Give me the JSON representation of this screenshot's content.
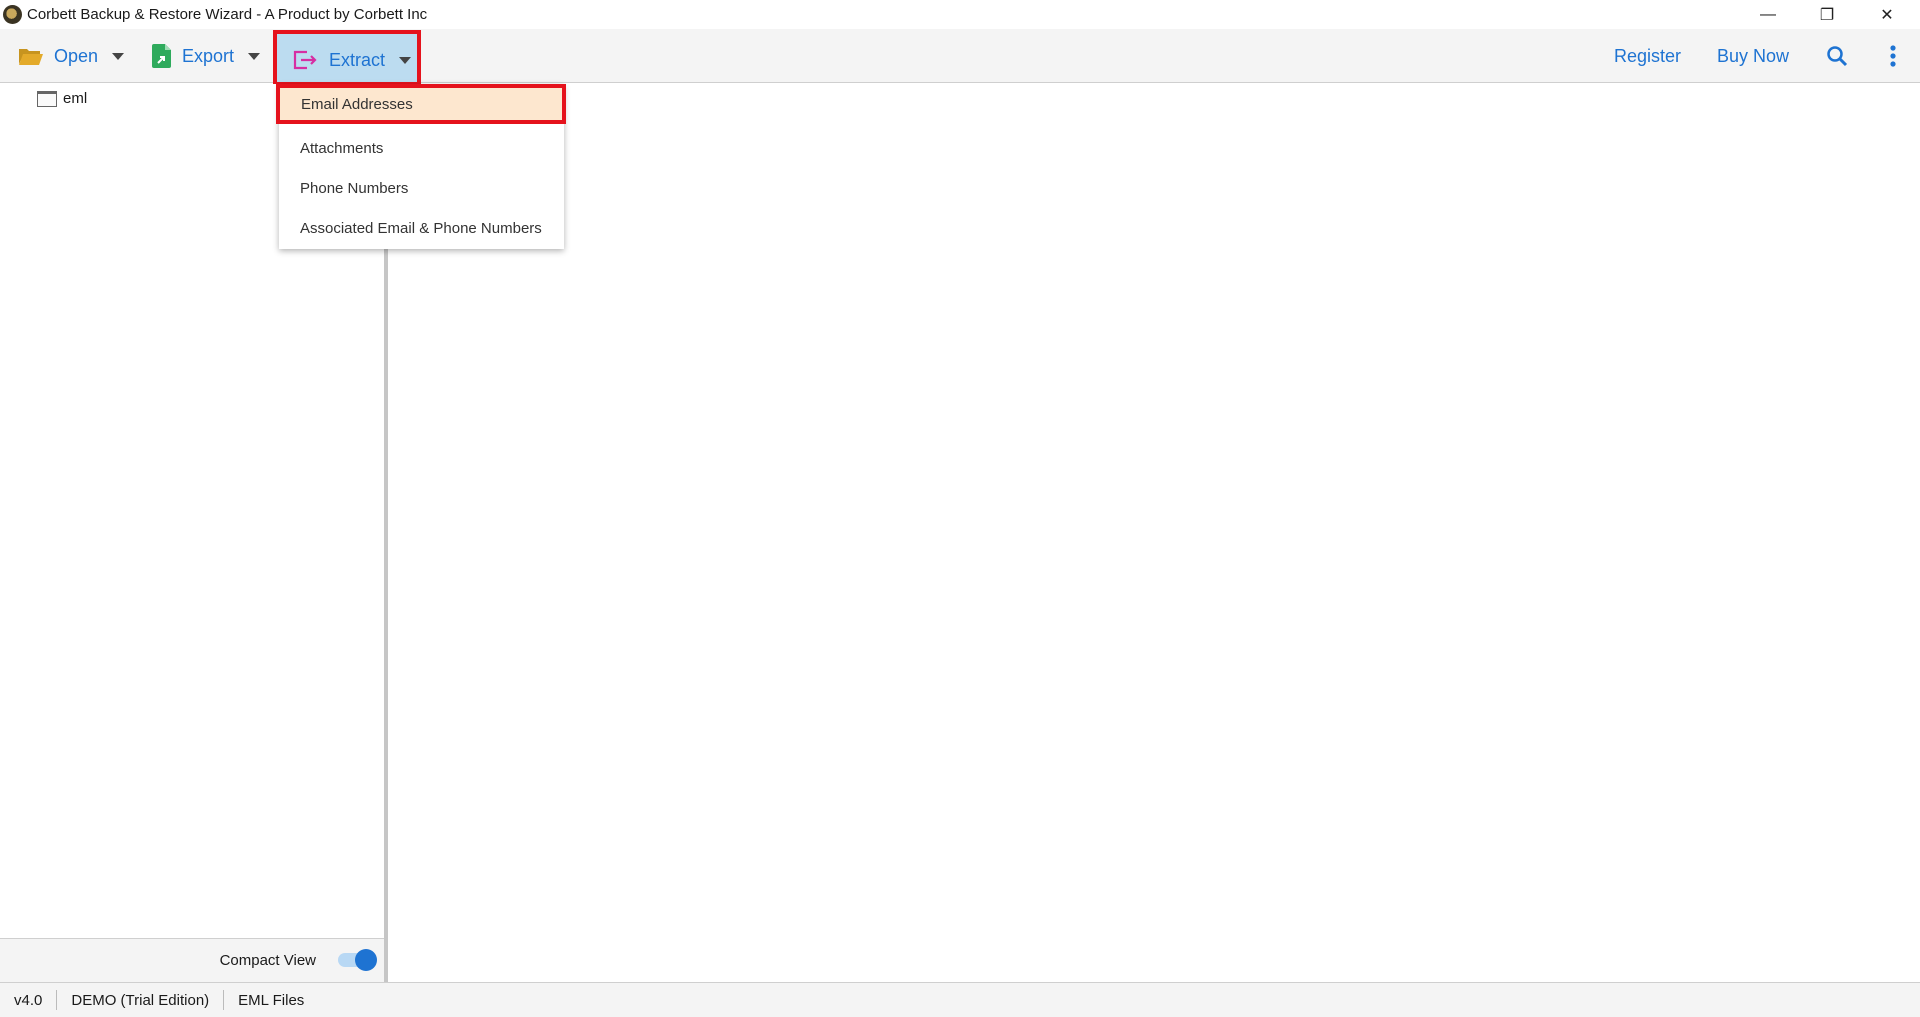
{
  "window": {
    "title": "Corbett Backup & Restore Wizard - A Product by Corbett Inc",
    "controls": {
      "minimize": "—",
      "restore": "❐",
      "close": "✕"
    }
  },
  "toolbar": {
    "open_label": "Open",
    "export_label": "Export",
    "extract_label": "Extract",
    "register_label": "Register",
    "buy_now_label": "Buy Now",
    "search_icon": "search-icon",
    "more_icon": "more-vertical-icon"
  },
  "extract_menu": {
    "items": [
      {
        "label": "Email Addresses",
        "highlighted": true
      },
      {
        "label": "Attachments"
      },
      {
        "label": "Phone Numbers"
      },
      {
        "label": "Associated Email & Phone Numbers"
      }
    ]
  },
  "tree": {
    "items": [
      {
        "label": "eml"
      }
    ]
  },
  "compact_view": {
    "label": "Compact View",
    "enabled": true
  },
  "status": {
    "version": "v4.0",
    "edition": "DEMO (Trial Edition)",
    "file_type": "EML Files"
  },
  "colors": {
    "accent": "#1e73d2",
    "highlight_border": "#e5121c",
    "menu_highlight": "#fde7cf",
    "active_tab": "#bcdcf0"
  }
}
